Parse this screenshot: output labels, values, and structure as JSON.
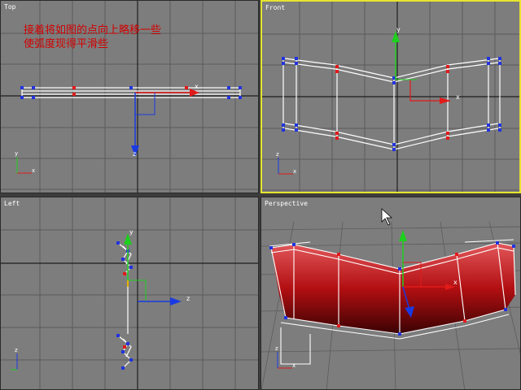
{
  "viewports": {
    "top": {
      "label": "Top"
    },
    "front": {
      "label": "Front"
    },
    "left": {
      "label": "Left"
    },
    "perspective": {
      "label": "Perspective"
    }
  },
  "annotation": {
    "line1": "接着将如图的点向上略移一些",
    "line2": "使弧度现得平滑些"
  },
  "axis_labels": {
    "x": "x",
    "y": "y",
    "z": "z"
  },
  "active_viewport": "front",
  "colors": {
    "active_border": "#e6e42e",
    "annotation": "#d20000",
    "x_axis": "#e11a1a",
    "y_axis": "#1ecf1e",
    "z_axis": "#1a3ae1",
    "mesh": "#b30f12"
  }
}
